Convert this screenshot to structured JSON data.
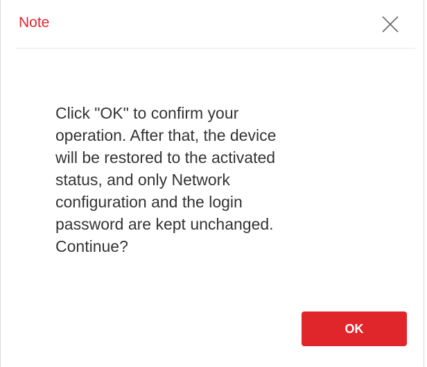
{
  "dialog": {
    "title": "Note",
    "close_icon": "close-icon",
    "message": "Click \"OK\" to confirm your\noperation. After that, the device\nwill be restored to the activated\nstatus, and only Network\nconfiguration and the login\npassword are kept unchanged.\nContinue?",
    "ok_label": "OK"
  },
  "colors": {
    "accent": "#e0252b",
    "text": "#333333",
    "divider": "#e6e6e6",
    "background": "#ffffff"
  }
}
